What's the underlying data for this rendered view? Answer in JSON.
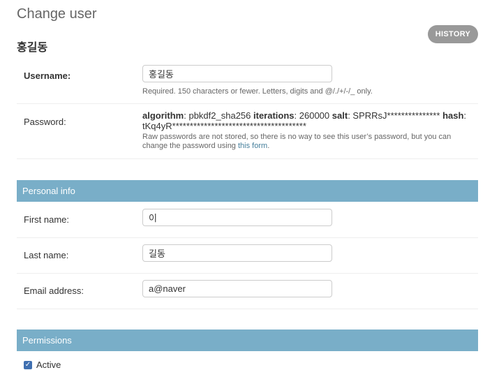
{
  "header": {
    "title": "Change user",
    "history_label": "HISTORY",
    "object_title": "홍길동"
  },
  "fields": {
    "username": {
      "label": "Username:",
      "value": "홍길동",
      "help": "Required. 150 characters or fewer. Letters, digits and @/./+/-/_ only."
    },
    "password": {
      "label": "Password:",
      "algorithm_key": "algorithm",
      "algorithm_value": "pbkdf2_sha256",
      "iterations_key": "iterations",
      "iterations_value": "260000",
      "salt_key": "salt",
      "salt_value": "SPRRsJ***************",
      "hash_key": "hash",
      "hash_value": "tKq4yR**************************************",
      "help_text": "Raw passwords are not stored, so there is no way to see this user’s password, but you can change the password using",
      "help_link": "this form",
      "help_end": "."
    }
  },
  "personal_info": {
    "heading": "Personal info",
    "first_name": {
      "label": "First name:",
      "value": "이"
    },
    "last_name": {
      "label": "Last name:",
      "value": "길동"
    },
    "email": {
      "label": "Email address:",
      "value": "a@naver"
    }
  },
  "permissions": {
    "heading": "Permissions",
    "active": {
      "label": "Active",
      "checked": true
    }
  },
  "colors": {
    "fieldset_header": "#79aec8",
    "link": "#447e9b",
    "history_button": "#999999",
    "checkbox": "#3f6fb0"
  }
}
